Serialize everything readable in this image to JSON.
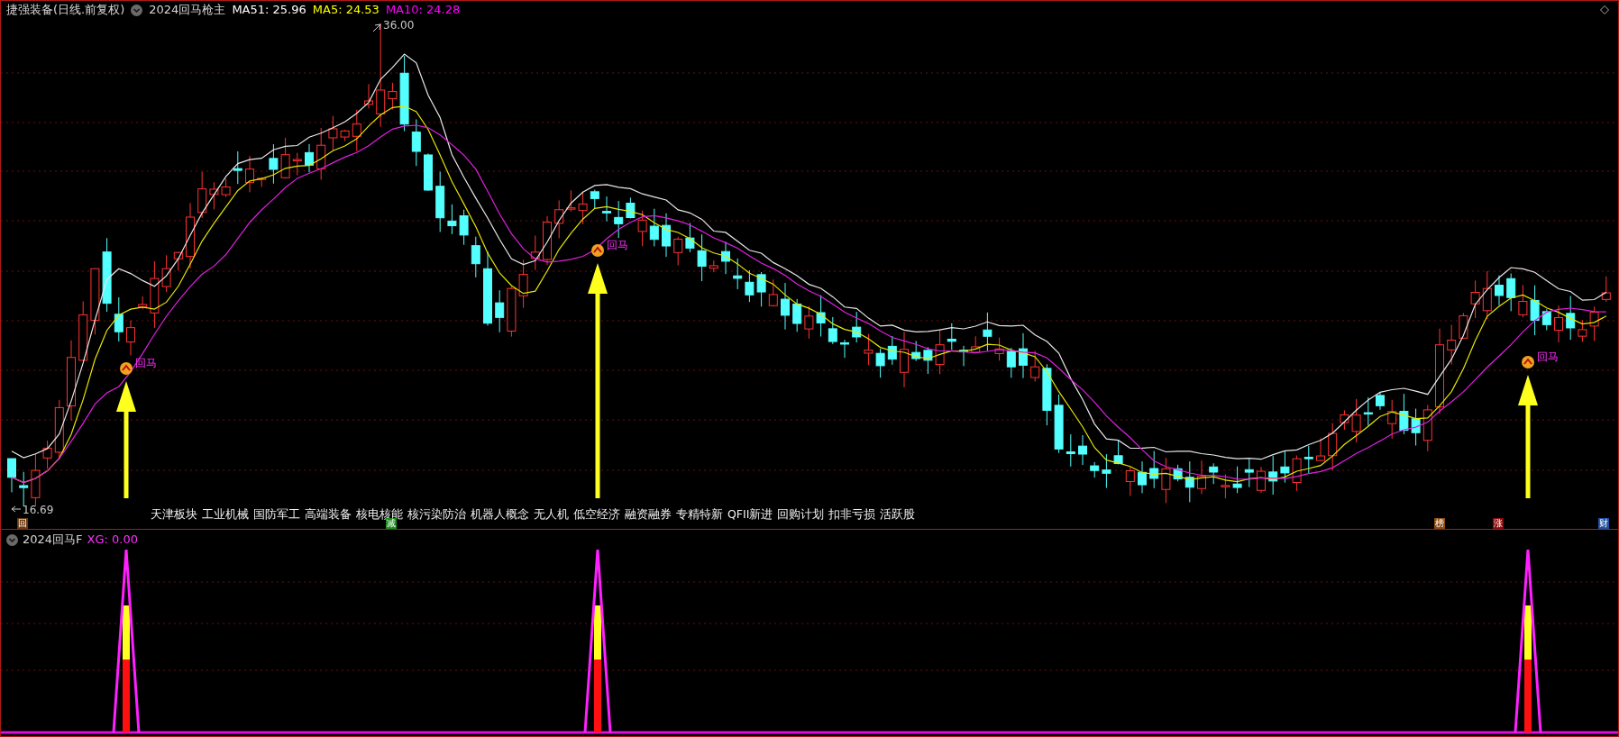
{
  "main_panel": {
    "stock_title": "捷强装备(日线.前复权)",
    "indicator_name": "2024回马枪主",
    "ma_readings": [
      {
        "label": "MA51: 25.96",
        "color": "#ffffff"
      },
      {
        "label": "MA5: 24.53",
        "color": "#ffff00"
      },
      {
        "label": "MA10: 24.28",
        "color": "#ff00ff"
      }
    ],
    "high_label": "36.00",
    "low_label": "16.69",
    "signals": [
      {
        "label": "回马"
      },
      {
        "label": "回马"
      },
      {
        "label": "回马"
      }
    ],
    "concepts": [
      "天津板块",
      "工业机械",
      "国防军工",
      "高端装备",
      "核电核能",
      "核污染防治",
      "机器人概念",
      "无人机",
      "低空经济",
      "融资融券",
      "专精特新",
      "QFII新进",
      "回购计划",
      "扣非亏损",
      "活跃股"
    ],
    "badges": [
      {
        "text": "回",
        "color": "#6b3a10"
      },
      {
        "text": "减",
        "color": "#1e8a1e"
      },
      {
        "text": "榜",
        "color": "#8b4a10"
      },
      {
        "text": "涨",
        "color": "#8b0a0a"
      },
      {
        "text": "财",
        "color": "#1f4fa0"
      }
    ]
  },
  "sub_panel": {
    "indicator_name": "2024回马F",
    "reading": "XG: 0.00"
  }
}
